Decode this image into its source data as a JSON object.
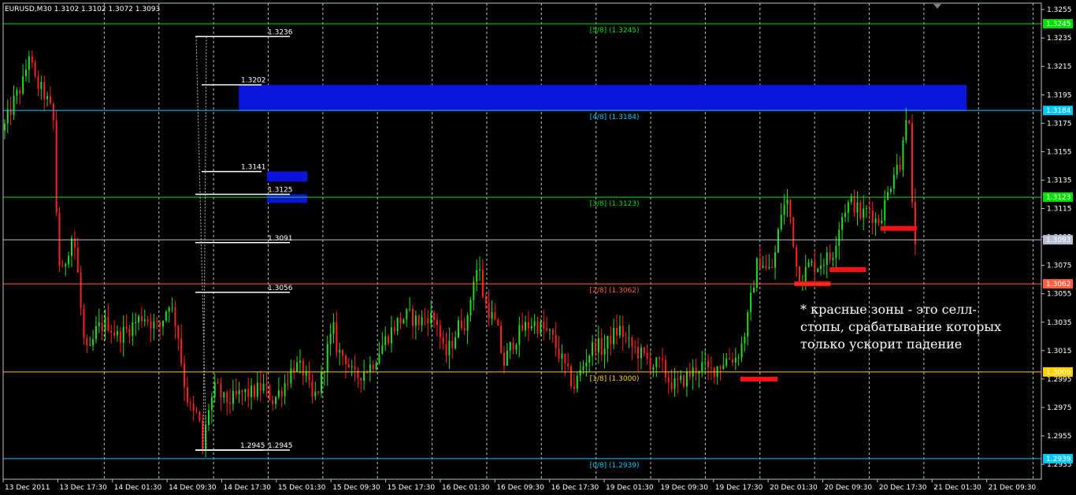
{
  "chart_data": {
    "type": "candlestick",
    "title": "EURUSD,M30  1.3102 1.3102 1.3072 1.3093",
    "ylim": [
      1.29245,
      1.32595
    ],
    "y_ticks": [
      "1.3255",
      "1.3235",
      "1.3215",
      "1.3195",
      "1.3175",
      "1.3155",
      "1.3135",
      "1.3115",
      "1.3095",
      "1.3075",
      "1.3055",
      "1.3035",
      "1.3015",
      "1.2995",
      "1.2975",
      "1.2955",
      "1.2935"
    ],
    "x_ticks": [
      "13 Dec 2011",
      "13 Dec 17:30",
      "14 Dec 01:30",
      "14 Dec 09:30",
      "14 Dec 17:30",
      "15 Dec 01:30",
      "15 Dec 09:30",
      "15 Dec 17:30",
      "16 Dec 01:30",
      "16 Dec 09:30",
      "16 Dec 17:30",
      "19 Dec 01:30",
      "19 Dec 09:30",
      "19 Dec 17:30",
      "20 Dec 01:30",
      "20 Dec 09:30",
      "20 Dec 17:30",
      "21 Dec 01:30",
      "21 Dec 09:30"
    ],
    "grid": true,
    "murrey_levels": [
      {
        "label": "[5/8]  (1.3245)",
        "price": 1.3245,
        "tag": "1.3245",
        "color": "#00e000",
        "tag_text": "#000"
      },
      {
        "label": "[4/8]  (1.3184)",
        "price": 1.3184,
        "tag": "1.3184",
        "color": "#00c8ff",
        "tag_text": "#000"
      },
      {
        "label": "[3/8]  (1.3123)",
        "price": 1.3123,
        "tag": "1.3123",
        "color": "#00e000",
        "tag_text": "#000"
      },
      {
        "label": "",
        "price": 1.3093,
        "tag": "1.3093",
        "color": "#b8c0d0",
        "tag_text": "#000"
      },
      {
        "label": "[2/8]  (1.3062)",
        "price": 1.3062,
        "tag": "1.3062",
        "color": "#ff6040",
        "tag_text": "#000"
      },
      {
        "label": "[1/8]  (1.3000)",
        "price": 1.3,
        "tag": "1.3000",
        "color": "#ffd000",
        "tag_text": "#000"
      },
      {
        "label": "[0/8]  (1.2939)",
        "price": 1.2939,
        "tag": "1.2939",
        "color": "#00c8ff",
        "tag_text": "#000"
      }
    ],
    "price_marks": [
      {
        "label": "1.3236",
        "price": 1.3236
      },
      {
        "label": "1.3202",
        "price": 1.3202
      },
      {
        "label": "1.3141",
        "price": 1.3141
      },
      {
        "label": "1.3125",
        "price": 1.3125
      },
      {
        "label": "1.3091",
        "price": 1.3091
      },
      {
        "label": "1.3056",
        "price": 1.3056
      },
      {
        "label": "1.2945",
        "price": 1.2945
      },
      {
        "label": "1.2945",
        "price": 1.2945
      }
    ],
    "blue_zones": [
      {
        "x0": 0.227,
        "x1": 0.928,
        "p_hi": 1.3202,
        "p_lo": 1.3184
      },
      {
        "x0": 0.254,
        "x1": 0.293,
        "p_hi": 1.3141,
        "p_lo": 1.3134
      },
      {
        "x0": 0.254,
        "x1": 0.293,
        "p_hi": 1.3125,
        "p_lo": 1.3119
      }
    ],
    "red_zones": [
      {
        "x0": 0.71,
        "x1": 0.746,
        "price": 1.2995
      },
      {
        "x0": 0.762,
        "x1": 0.797,
        "price": 1.3062
      },
      {
        "x0": 0.796,
        "x1": 0.831,
        "price": 1.3072
      },
      {
        "x0": 0.845,
        "x1": 0.88,
        "price": 1.3101
      }
    ],
    "annotation": [
      "* красные зоны - это селл-",
      "стопы, срабатывание которых",
      "только ускорит падение"
    ],
    "bull_color": "#22dd22",
    "bear_color": "#ff2020",
    "path": [
      [
        0.0,
        1.317
      ],
      [
        0.01,
        1.319
      ],
      [
        0.02,
        1.3205
      ],
      [
        0.025,
        1.3225
      ],
      [
        0.03,
        1.3205
      ],
      [
        0.04,
        1.3195
      ],
      [
        0.048,
        1.318
      ],
      [
        0.05,
        1.316
      ],
      [
        0.052,
        1.309
      ],
      [
        0.056,
        1.3065
      ],
      [
        0.062,
        1.3085
      ],
      [
        0.066,
        1.3095
      ],
      [
        0.07,
        1.3085
      ],
      [
        0.074,
        1.305
      ],
      [
        0.078,
        1.302
      ],
      [
        0.082,
        1.301
      ],
      [
        0.09,
        1.303
      ],
      [
        0.1,
        1.3035
      ],
      [
        0.11,
        1.3025
      ],
      [
        0.12,
        1.303
      ],
      [
        0.135,
        1.304
      ],
      [
        0.15,
        1.303
      ],
      [
        0.16,
        1.305
      ],
      [
        0.168,
        1.303
      ],
      [
        0.172,
        1.3005
      ],
      [
        0.176,
        1.2985
      ],
      [
        0.182,
        1.297
      ],
      [
        0.188,
        1.297
      ],
      [
        0.192,
        1.2945
      ],
      [
        0.198,
        1.2975
      ],
      [
        0.205,
        1.299
      ],
      [
        0.212,
        1.298
      ],
      [
        0.22,
        1.298
      ],
      [
        0.23,
        1.2985
      ],
      [
        0.24,
        1.2985
      ],
      [
        0.25,
        1.299
      ],
      [
        0.26,
        1.298
      ],
      [
        0.27,
        1.299
      ],
      [
        0.28,
        1.3005
      ],
      [
        0.29,
        1.3
      ],
      [
        0.298,
        1.298
      ],
      [
        0.305,
        1.299
      ],
      [
        0.312,
        1.3015
      ],
      [
        0.318,
        1.303
      ],
      [
        0.322,
        1.3015
      ],
      [
        0.33,
        1.301
      ],
      [
        0.338,
        1.2995
      ],
      [
        0.346,
        1.3
      ],
      [
        0.355,
        1.3005
      ],
      [
        0.362,
        1.3015
      ],
      [
        0.37,
        1.3025
      ],
      [
        0.38,
        1.3035
      ],
      [
        0.39,
        1.304
      ],
      [
        0.4,
        1.3035
      ],
      [
        0.41,
        1.304
      ],
      [
        0.418,
        1.3035
      ],
      [
        0.425,
        1.301
      ],
      [
        0.432,
        1.302
      ],
      [
        0.44,
        1.3035
      ],
      [
        0.448,
        1.3035
      ],
      [
        0.452,
        1.3065
      ],
      [
        0.458,
        1.3075
      ],
      [
        0.463,
        1.305
      ],
      [
        0.47,
        1.304
      ],
      [
        0.476,
        1.303
      ],
      [
        0.482,
        1.3005
      ],
      [
        0.49,
        1.302
      ],
      [
        0.5,
        1.303
      ],
      [
        0.51,
        1.3035
      ],
      [
        0.52,
        1.303
      ],
      [
        0.528,
        1.3025
      ],
      [
        0.534,
        1.3015
      ],
      [
        0.54,
        1.3005
      ],
      [
        0.546,
        1.2995
      ],
      [
        0.55,
        1.299
      ],
      [
        0.556,
        1.3
      ],
      [
        0.562,
        1.301
      ],
      [
        0.57,
        1.302
      ],
      [
        0.578,
        1.3015
      ],
      [
        0.586,
        1.3025
      ],
      [
        0.594,
        1.303
      ],
      [
        0.602,
        1.302
      ],
      [
        0.61,
        1.3015
      ],
      [
        0.618,
        1.301
      ],
      [
        0.626,
        1.3005
      ],
      [
        0.634,
        1.3005
      ],
      [
        0.64,
        1.2995
      ],
      [
        0.648,
        1.299
      ],
      [
        0.656,
        1.2995
      ],
      [
        0.664,
        1.3
      ],
      [
        0.672,
        1.3005
      ],
      [
        0.68,
        1.3
      ],
      [
        0.69,
        1.3005
      ],
      [
        0.698,
        1.301
      ],
      [
        0.706,
        1.301
      ],
      [
        0.712,
        1.302
      ],
      [
        0.718,
        1.304
      ],
      [
        0.722,
        1.306
      ],
      [
        0.726,
        1.3075
      ],
      [
        0.73,
        1.308
      ],
      [
        0.736,
        1.307
      ],
      [
        0.742,
        1.3075
      ],
      [
        0.746,
        1.3095
      ],
      [
        0.75,
        1.3115
      ],
      [
        0.756,
        1.312
      ],
      [
        0.76,
        1.31
      ],
      [
        0.764,
        1.3075
      ],
      [
        0.768,
        1.3065
      ],
      [
        0.776,
        1.3075
      ],
      [
        0.784,
        1.3075
      ],
      [
        0.792,
        1.308
      ],
      [
        0.798,
        1.308
      ],
      [
        0.804,
        1.31
      ],
      [
        0.81,
        1.3115
      ],
      [
        0.818,
        1.312
      ],
      [
        0.826,
        1.311
      ],
      [
        0.834,
        1.3115
      ],
      [
        0.842,
        1.3105
      ],
      [
        0.848,
        1.3115
      ],
      [
        0.854,
        1.313
      ],
      [
        0.86,
        1.315
      ],
      [
        0.864,
        1.314
      ],
      [
        0.868,
        1.318
      ],
      [
        0.872,
        1.3185
      ],
      [
        0.875,
        1.312
      ],
      [
        0.878,
        1.3093
      ],
      [
        0.88,
        1.3093
      ]
    ]
  }
}
